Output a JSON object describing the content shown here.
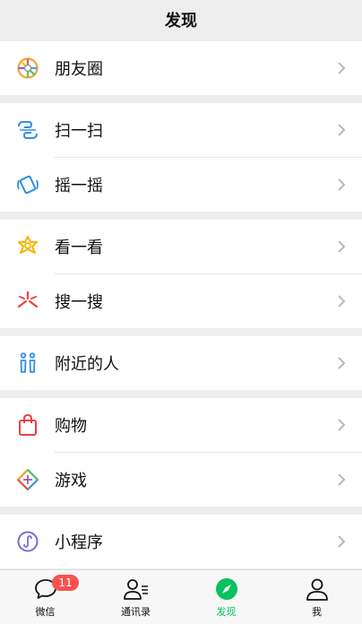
{
  "header": {
    "title": "发现"
  },
  "groups": [
    {
      "items": [
        {
          "label": "朋友圈",
          "icon": "moments-icon"
        }
      ]
    },
    {
      "items": [
        {
          "label": "扫一扫",
          "icon": "scan-icon"
        },
        {
          "label": "摇一摇",
          "icon": "shake-icon"
        }
      ]
    },
    {
      "items": [
        {
          "label": "看一看",
          "icon": "top-stories-icon"
        },
        {
          "label": "搜一搜",
          "icon": "search-icon"
        }
      ]
    },
    {
      "items": [
        {
          "label": "附近的人",
          "icon": "people-nearby-icon"
        }
      ]
    },
    {
      "items": [
        {
          "label": "购物",
          "icon": "shopping-bag-icon"
        },
        {
          "label": "游戏",
          "icon": "games-icon"
        }
      ]
    },
    {
      "items": [
        {
          "label": "小程序",
          "icon": "mini-programs-icon"
        }
      ]
    }
  ],
  "tabbar": {
    "tabs": [
      {
        "label": "微信",
        "badge": "11"
      },
      {
        "label": "通讯录"
      },
      {
        "label": "发现"
      },
      {
        "label": "我"
      }
    ]
  },
  "colors": {
    "accent": "#07c160",
    "badge": "#fa5151"
  }
}
